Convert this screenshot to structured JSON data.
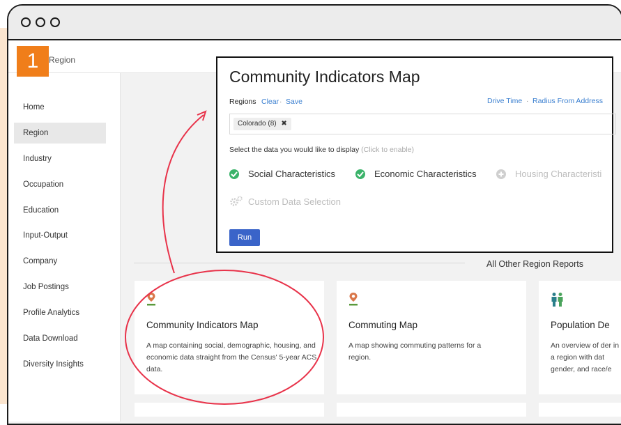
{
  "step_badge": "1",
  "breadcrumb": "Region",
  "sidebar": {
    "items": [
      {
        "label": "Home"
      },
      {
        "label": "Region",
        "active": true
      },
      {
        "label": "Industry"
      },
      {
        "label": "Occupation"
      },
      {
        "label": "Education"
      },
      {
        "label": "Input-Output"
      },
      {
        "label": "Company"
      },
      {
        "label": "Job Postings"
      },
      {
        "label": "Profile Analytics"
      },
      {
        "label": "Data Download"
      },
      {
        "label": "Diversity Insights"
      }
    ]
  },
  "popup": {
    "title": "Community Indicators Map",
    "regions_label": "Regions",
    "clear_link": "Clear",
    "save_link": "Save",
    "separator": "·",
    "drive_time_link": "Drive Time",
    "radius_link": "Radius From Address",
    "region_chip": "Colorado (8)",
    "chip_remove": "✖",
    "select_prompt": "Select the data you would like to display",
    "select_hint": "(Click to enable)",
    "options": [
      {
        "label": "Social Characteristics",
        "enabled": true
      },
      {
        "label": "Economic Characteristics",
        "enabled": true
      },
      {
        "label": "Housing Characteristi",
        "enabled": false
      }
    ],
    "custom_label": "Custom Data Selection",
    "run_label": "Run"
  },
  "right_fragment": "n",
  "section_title": "All Other Region Reports",
  "cards": [
    {
      "title": "Community Indicators Map",
      "description": "A map containing social, demographic, housing, and economic data straight from the Census' 5-year ACS data.",
      "icon": "map-pin-icon"
    },
    {
      "title": "Commuting Map",
      "description": "A map showing commuting patterns for a region.",
      "icon": "map-pin-icon"
    },
    {
      "title": "Population De",
      "description": "An overview of der in a region with dat gender, and race/e",
      "icon": "people-icon"
    }
  ],
  "colors": {
    "accent_orange": "#f07e1a",
    "annotation_red": "#e8334a",
    "check_green": "#3bb36a",
    "run_blue": "#3a64c9",
    "link_blue": "#3a7fd0"
  }
}
